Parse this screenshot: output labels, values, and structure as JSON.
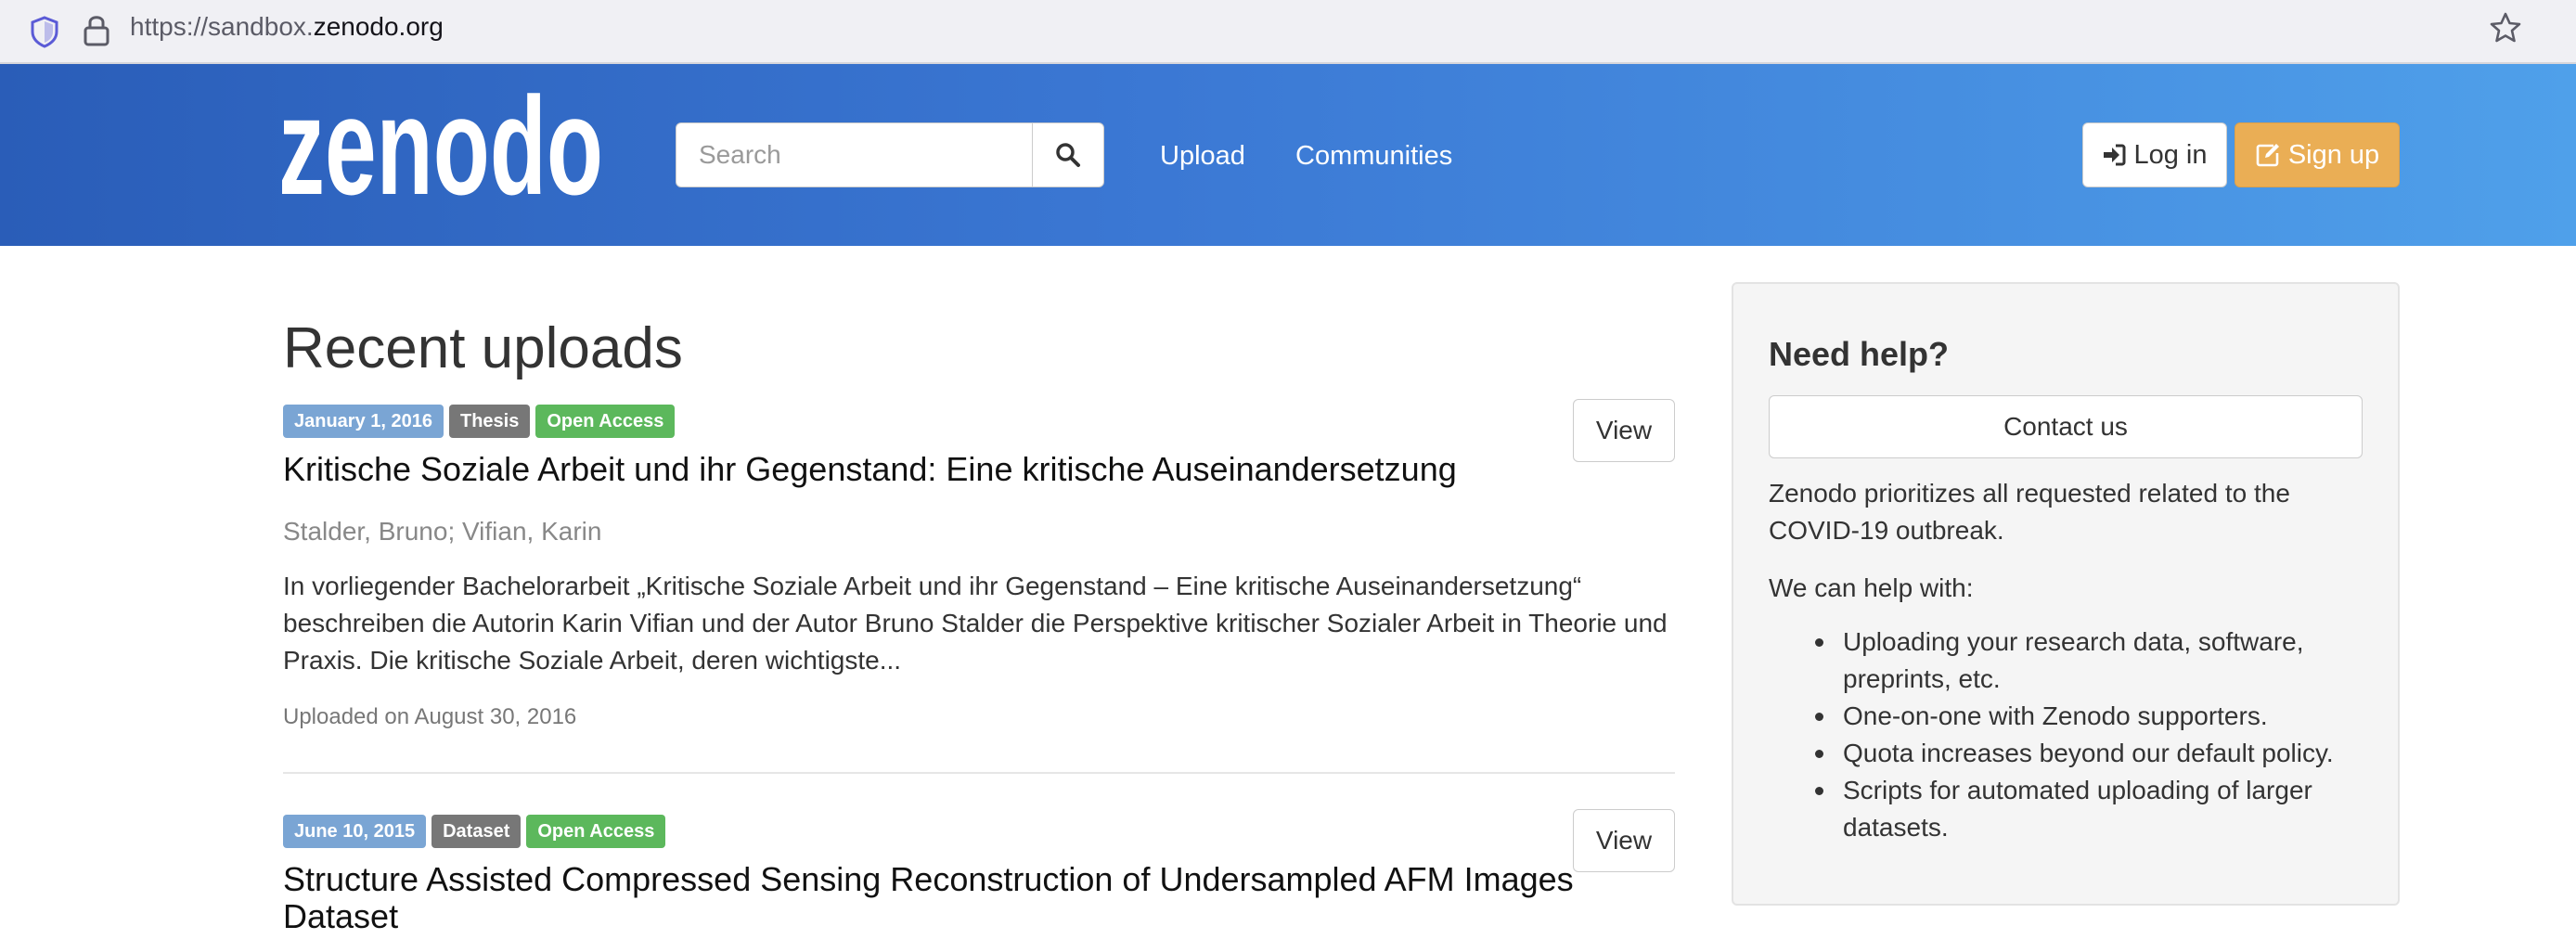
{
  "browser": {
    "url_prefix": "https://sandbox.",
    "url_domain": "zenodo.org"
  },
  "header": {
    "logo_text": "zenodo",
    "search_placeholder": "Search",
    "nav": {
      "upload": "Upload",
      "communities": "Communities"
    },
    "login_label": "Log in",
    "signup_label": "Sign up"
  },
  "main": {
    "title": "Recent uploads",
    "records": [
      {
        "date": "January 1, 2016",
        "type": "Thesis",
        "access": "Open Access",
        "title": "Kritische Soziale Arbeit und ihr Gegenstand: Eine kritische Auseinandersetzung",
        "authors": "Stalder, Bruno; Vifian, Karin",
        "description": "In vorliegender Bachelorarbeit „Kritische Soziale Arbeit und ihr Gegenstand – Eine kritische Auseinandersetzung“ beschreiben die Autorin Karin Vifian und der Autor Bruno Stalder die Perspektive kritischer Sozialer Arbeit in Theorie und Praxis. Die kritische Soziale Arbeit, deren wichtigste...",
        "uploaded": "Uploaded on August 30, 2016",
        "view_label": "View"
      },
      {
        "date": "June 10, 2015",
        "type": "Dataset",
        "access": "Open Access",
        "title": "Structure Assisted Compressed Sensing Reconstruction of Undersampled AFM Images Dataset",
        "view_label": "View"
      }
    ]
  },
  "sidebar": {
    "title": "Need help?",
    "contact_label": "Contact us",
    "text": "Zenodo prioritizes all requested related to the COVID-19 outbreak.",
    "subtitle": "We can help with:",
    "items": [
      "Uploading your research data, software, preprints, etc.",
      "One-on-one with Zenodo supporters.",
      "Quota increases beyond our default policy.",
      "Scripts for automated uploading of larger datasets."
    ]
  },
  "colors": {
    "header_start": "#2a5db8",
    "header_end": "#4fa0ea",
    "signup": "#eaae55",
    "badge_date": "#7aa5d4",
    "badge_type": "#777777",
    "badge_access": "#5cb85c"
  }
}
